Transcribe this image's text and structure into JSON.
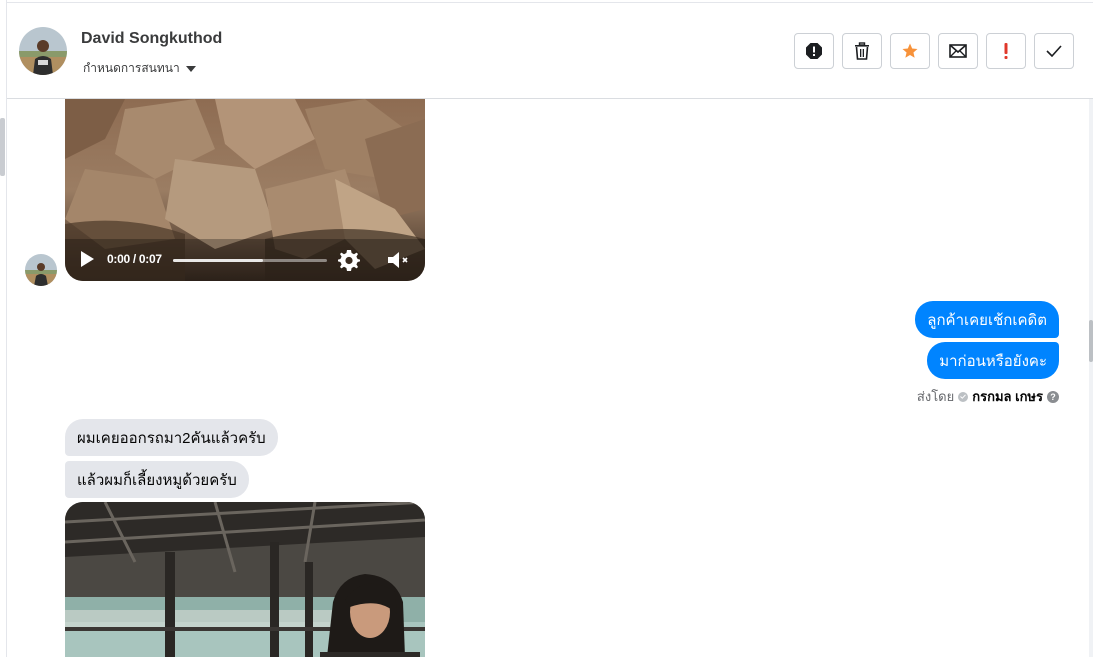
{
  "header": {
    "contact_name": "David Songkuthod",
    "conversation_setting": "กำหนดการสนทนา",
    "actions": [
      {
        "name": "report-spam",
        "icon": "alert-octagon-icon"
      },
      {
        "name": "delete",
        "icon": "trash-icon"
      },
      {
        "name": "star",
        "icon": "star-icon",
        "color": "#f7923a"
      },
      {
        "name": "mark-unread",
        "icon": "envelope-icon"
      },
      {
        "name": "follow-up",
        "icon": "exclamation-icon",
        "color": "#e0382b"
      },
      {
        "name": "mark-done",
        "icon": "checkmark-icon"
      }
    ]
  },
  "messages": {
    "video1": {
      "time": "0:00 / 0:07",
      "progress_fraction": 0
    },
    "outgoing": [
      "ลูกค้าเคยเช้กเคดิต",
      "มาก่อนหรือยังคะ"
    ],
    "sent_by_label": "ส่งโดย",
    "sent_by_agent": "กรกมล เกษร",
    "incoming": [
      "ผมเคยออกรถมา2คันแล้วครับ",
      "แล้วผมก็เลี้ยงหมูด้วยครับ"
    ]
  },
  "colors": {
    "outgoing_bubble": "#0084ff",
    "incoming_bubble": "#e4e6eb",
    "star": "#f7923a",
    "follow_up": "#e0382b"
  }
}
